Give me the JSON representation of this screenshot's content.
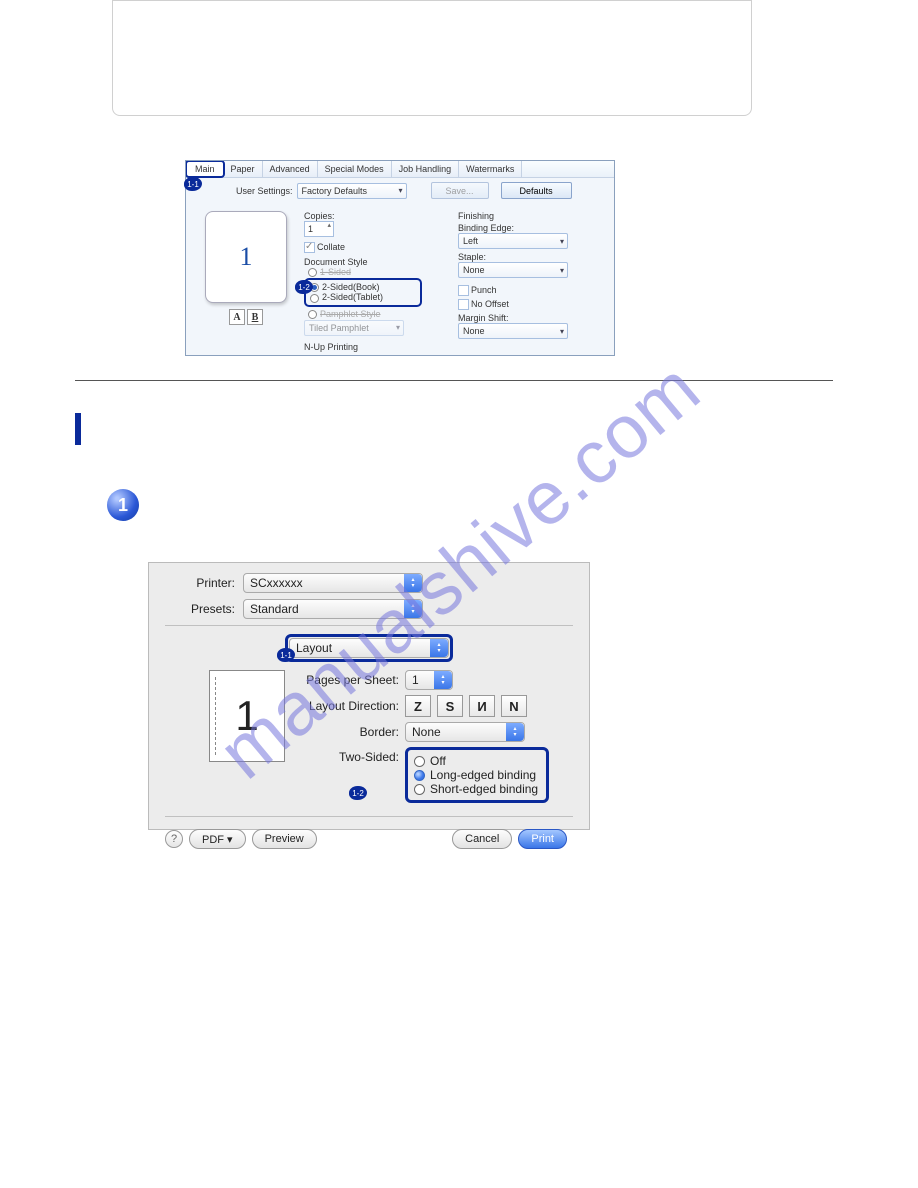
{
  "watermark": "manualshive.com",
  "win": {
    "tabs": [
      "Main",
      "Paper",
      "Advanced",
      "Special Modes",
      "Job Handling",
      "Watermarks"
    ],
    "badge11": "1-1",
    "user_settings_label": "User Settings:",
    "user_settings_value": "Factory Defaults",
    "save_btn": "Save...",
    "defaults_btn": "Defaults",
    "preview_num": "1",
    "ab_a": "A",
    "ab_b": "B",
    "copies_label": "Copies:",
    "copies_value": "1",
    "collate_label": "Collate",
    "doc_style_label": "Document Style",
    "ds_1sided": "1-Sided",
    "ds_book": "2-Sided(Book)",
    "ds_tablet": "2-Sided(Tablet)",
    "ds_pamphlet_label": "Pamphlet Style",
    "ds_pamphlet_value": "Tiled Pamphlet",
    "nup_label": "N-Up Printing",
    "badge12": "1-2",
    "finishing_label": "Finishing",
    "binding_edge_label": "Binding Edge:",
    "binding_edge_value": "Left",
    "staple_label": "Staple:",
    "staple_value": "None",
    "punch_label": "Punch",
    "no_offset_label": "No Offset",
    "margin_shift_label": "Margin Shift:",
    "margin_shift_value": "None"
  },
  "step_circle": "1",
  "mac": {
    "printer_label": "Printer:",
    "printer_value": "SCxxxxxx",
    "presets_label": "Presets:",
    "presets_value": "Standard",
    "layout_value": "Layout",
    "badge11": "1-1",
    "pps_label": "Pages per Sheet:",
    "pps_value": "1",
    "layout_dir_label": "Layout Direction:",
    "ld1": "Z",
    "ld2": "S",
    "ld3": "И",
    "ld4": "N",
    "border_label": "Border:",
    "border_value": "None",
    "twosided_label": "Two-Sided:",
    "ts_off": "Off",
    "ts_long": "Long-edged binding",
    "ts_short": "Short-edged binding",
    "badge12": "1-2",
    "preview_num": "1",
    "help": "?",
    "pdf_btn": "PDF ▾",
    "preview_btn": "Preview",
    "cancel_btn": "Cancel",
    "print_btn": "Print"
  }
}
